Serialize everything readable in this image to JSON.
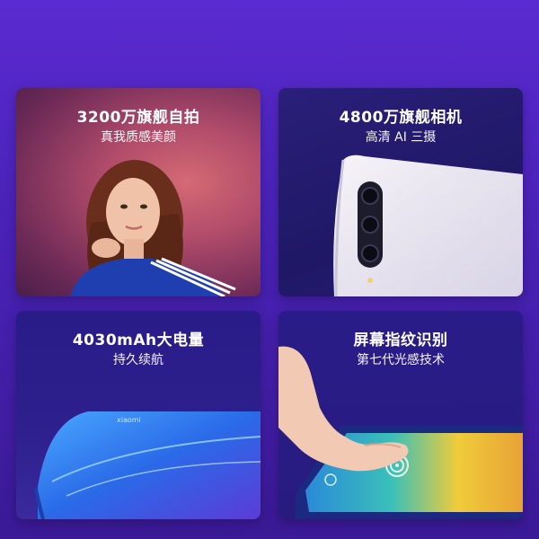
{
  "cards": [
    {
      "title": "3200万旗舰自拍",
      "subtitle": "真我质感美颜"
    },
    {
      "title": "4800万旗舰相机",
      "subtitle": "高清 AI 三摄"
    },
    {
      "title": "4030mAh大电量",
      "subtitle": "持久续航"
    },
    {
      "title": "屏幕指纹识别",
      "subtitle": "第七代光感技术"
    }
  ],
  "phone_brand": "xiaomi"
}
